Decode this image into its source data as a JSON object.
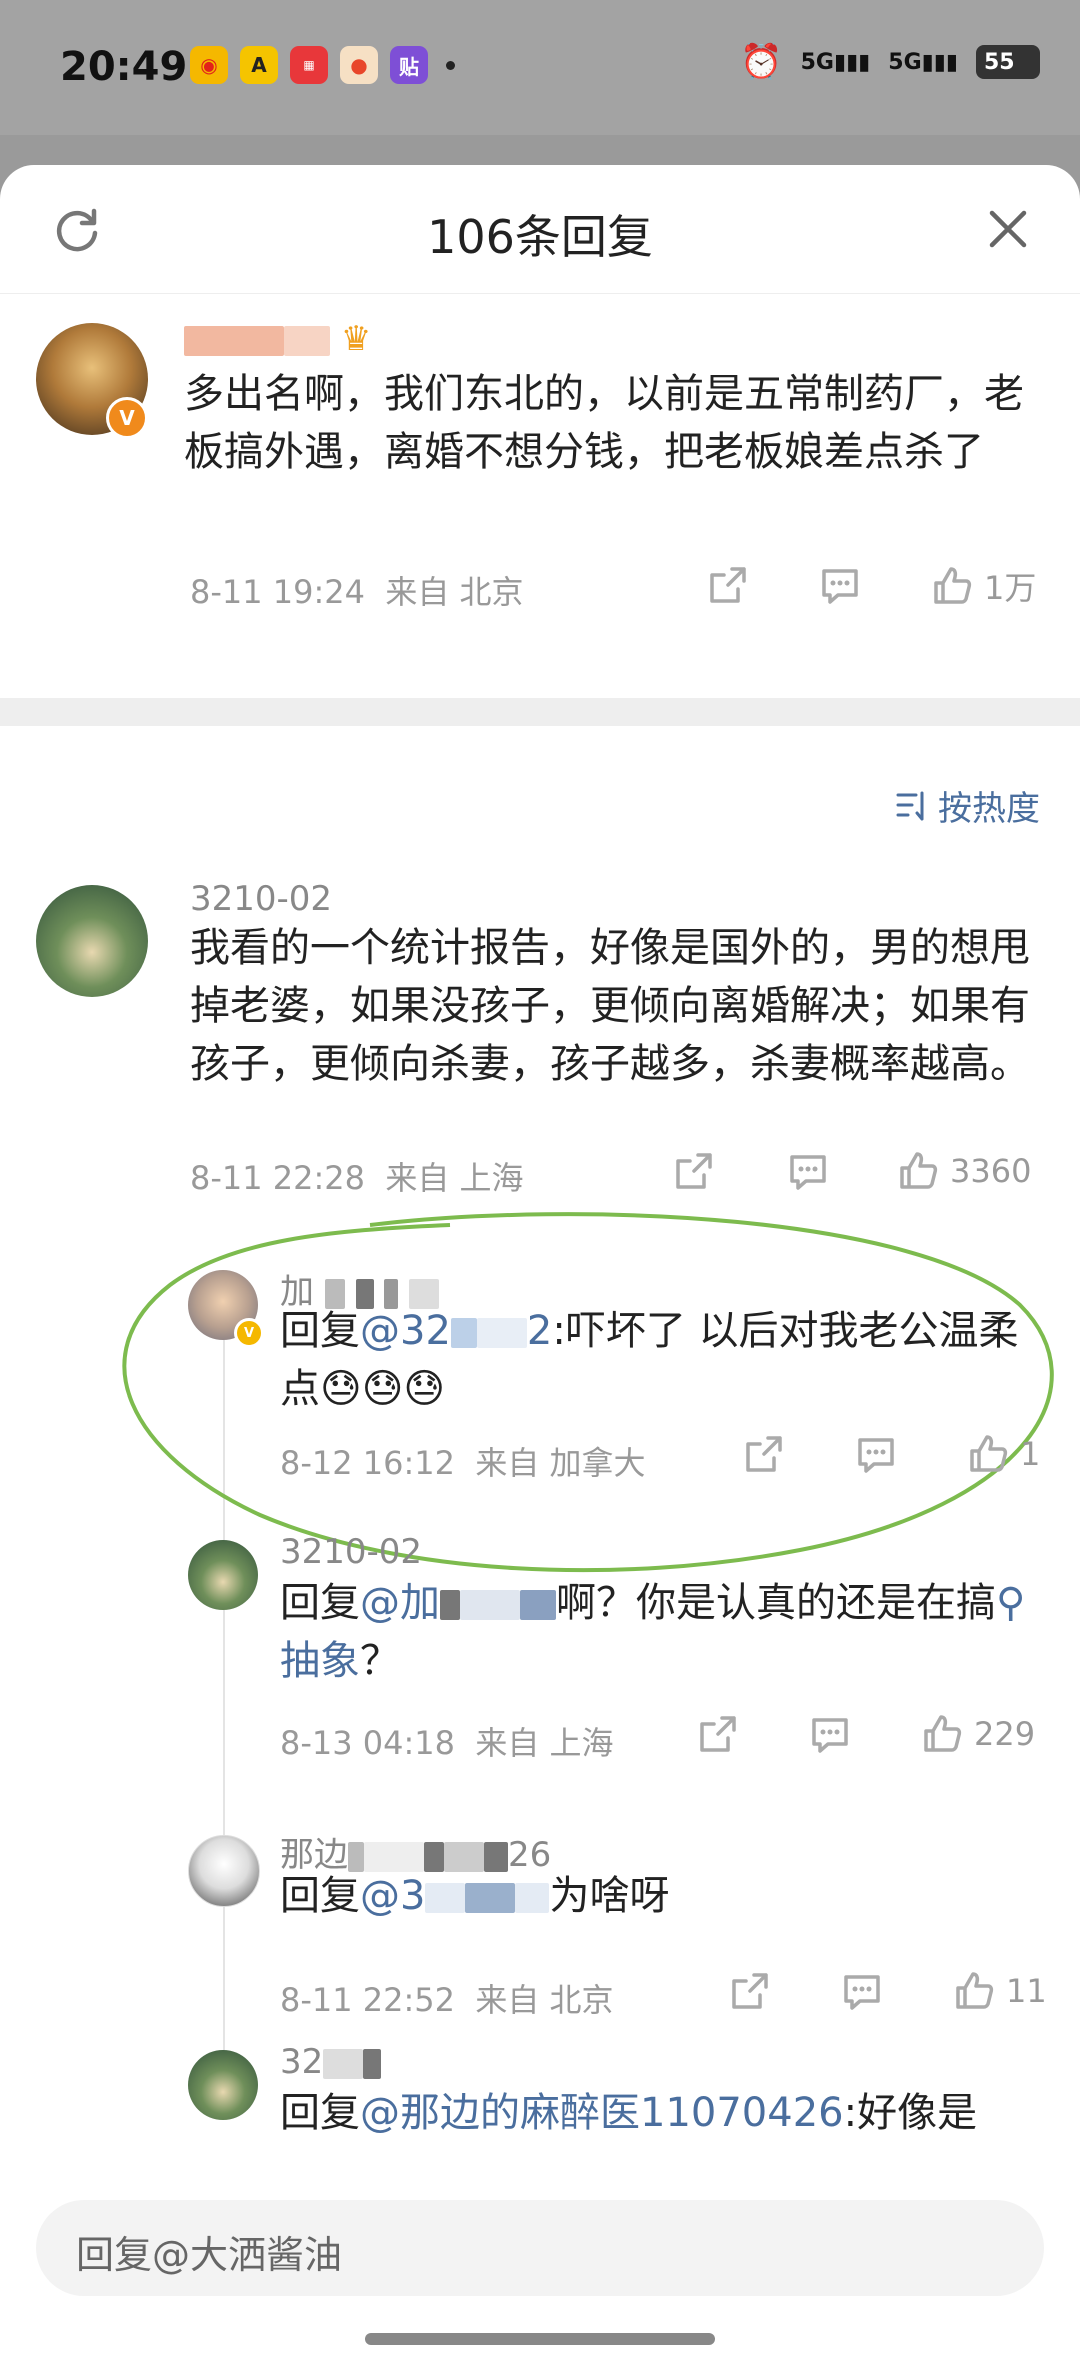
{
  "status": {
    "time": "20:49",
    "signal1": "5G",
    "signal2": "5G",
    "battery": "55"
  },
  "sheet": {
    "title": "106条回复"
  },
  "main_comment": {
    "text": "多出名啊，我们东北的，以前是五常制药厂，老板搞外遇，离婚不想分钱，把老板娘差点杀了",
    "time": "8-11 19:24",
    "location": "来自 北京",
    "likes": "1万"
  },
  "sort_label": "按热度",
  "replies": [
    {
      "name": "3210-02",
      "text": "我看的一个统计报告，好像是国外的，男的想甩掉老婆，如果没孩子，更倾向离婚解决；如果有孩子，更倾向杀妻，孩子越多，杀妻概率越高。",
      "time": "8-11 22:28",
      "location": "来自 上海",
      "likes": "3360"
    },
    {
      "name": "加",
      "prefix": "回复",
      "mention": "@32",
      "mention_tail": "2",
      "text": ":吓坏了 以后对我老公温柔点",
      "emoji": "😓😓😓",
      "time": "8-12 16:12",
      "location": "来自 加拿大",
      "likes": "1"
    },
    {
      "name": "3210-02",
      "prefix": "回复",
      "mention": "@加",
      "text_a": "啊？你是认真的还是在搞",
      "search_word": "抽象",
      "text_b": "？",
      "time": "8-13 04:18",
      "location": "来自 上海",
      "likes": "229"
    },
    {
      "name": "那边",
      "name_tail": "26",
      "prefix": "回复",
      "mention": "@3",
      "text": "为啥呀",
      "time": "8-11 22:52",
      "location": "来自 北京",
      "likes": "11"
    },
    {
      "name": "32",
      "prefix": "回复",
      "mention": "@那边的麻醉医11070426",
      "text": ":好像是"
    }
  ],
  "input": {
    "placeholder": "回复@大洒酱油"
  }
}
